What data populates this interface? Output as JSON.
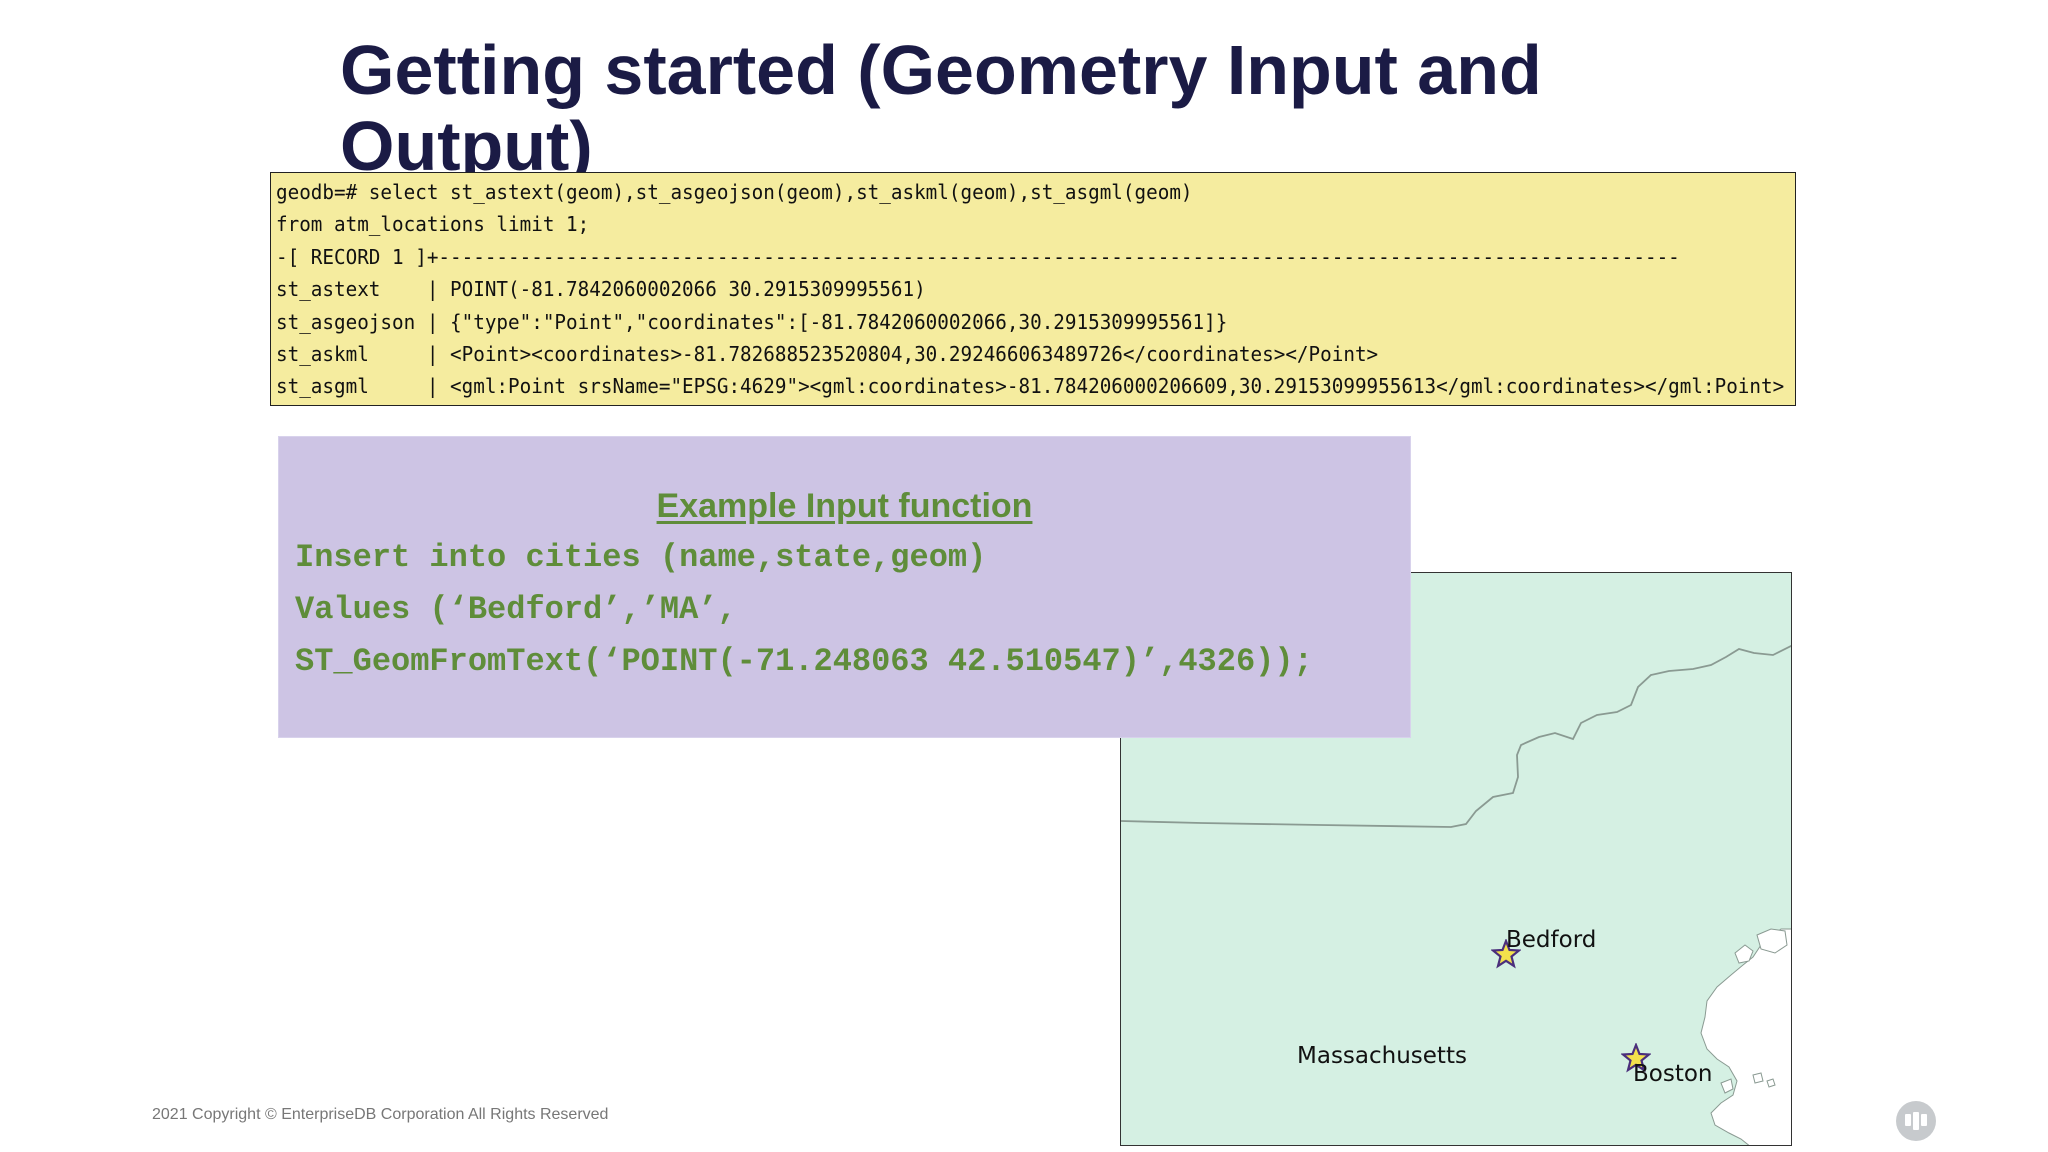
{
  "slide": {
    "title": "Getting started (Geometry Input and Output)"
  },
  "query_output": {
    "lines": [
      "geodb=# select st_astext(geom),st_asgeojson(geom),st_askml(geom),st_asgml(geom)",
      "from atm_locations limit 1;",
      "-[ RECORD 1 ]+-----------------------------------------------------------------------------------------------------------",
      "st_astext    | POINT(-81.7842060002066 30.2915309995561)",
      "st_asgeojson | {\"type\":\"Point\",\"coordinates\":[-81.7842060002066,30.2915309995561]}",
      "st_askml     | <Point><coordinates>-81.782688523520804,30.292466063489726</coordinates></Point>",
      "st_asgml     | <gml:Point srsName=\"EPSG:4629\"><gml:coordinates>-81.784206000206609,30.29153099955613</gml:coordinates></gml:Point>"
    ]
  },
  "input_example": {
    "title": "Example Input function",
    "lines": [
      "Insert into cities (name,state,geom)",
      "Values (‘Bedford’,’MA’,",
      "ST_GeomFromText(‘POINT(-71.248063 42.510547)’,4326));"
    ]
  },
  "map": {
    "state_label": "Massachusetts",
    "city_1": "Bedford",
    "city_2": "Boston",
    "land_color": "#d5f0e3",
    "star_fill": "#f3e14c",
    "star_stroke": "#4b2f7c"
  },
  "footer": {
    "copyright": "2021 Copyright © EnterpriseDB Corporation All Rights Reserved"
  },
  "logo": {
    "icon": "edb-logo-icon"
  }
}
